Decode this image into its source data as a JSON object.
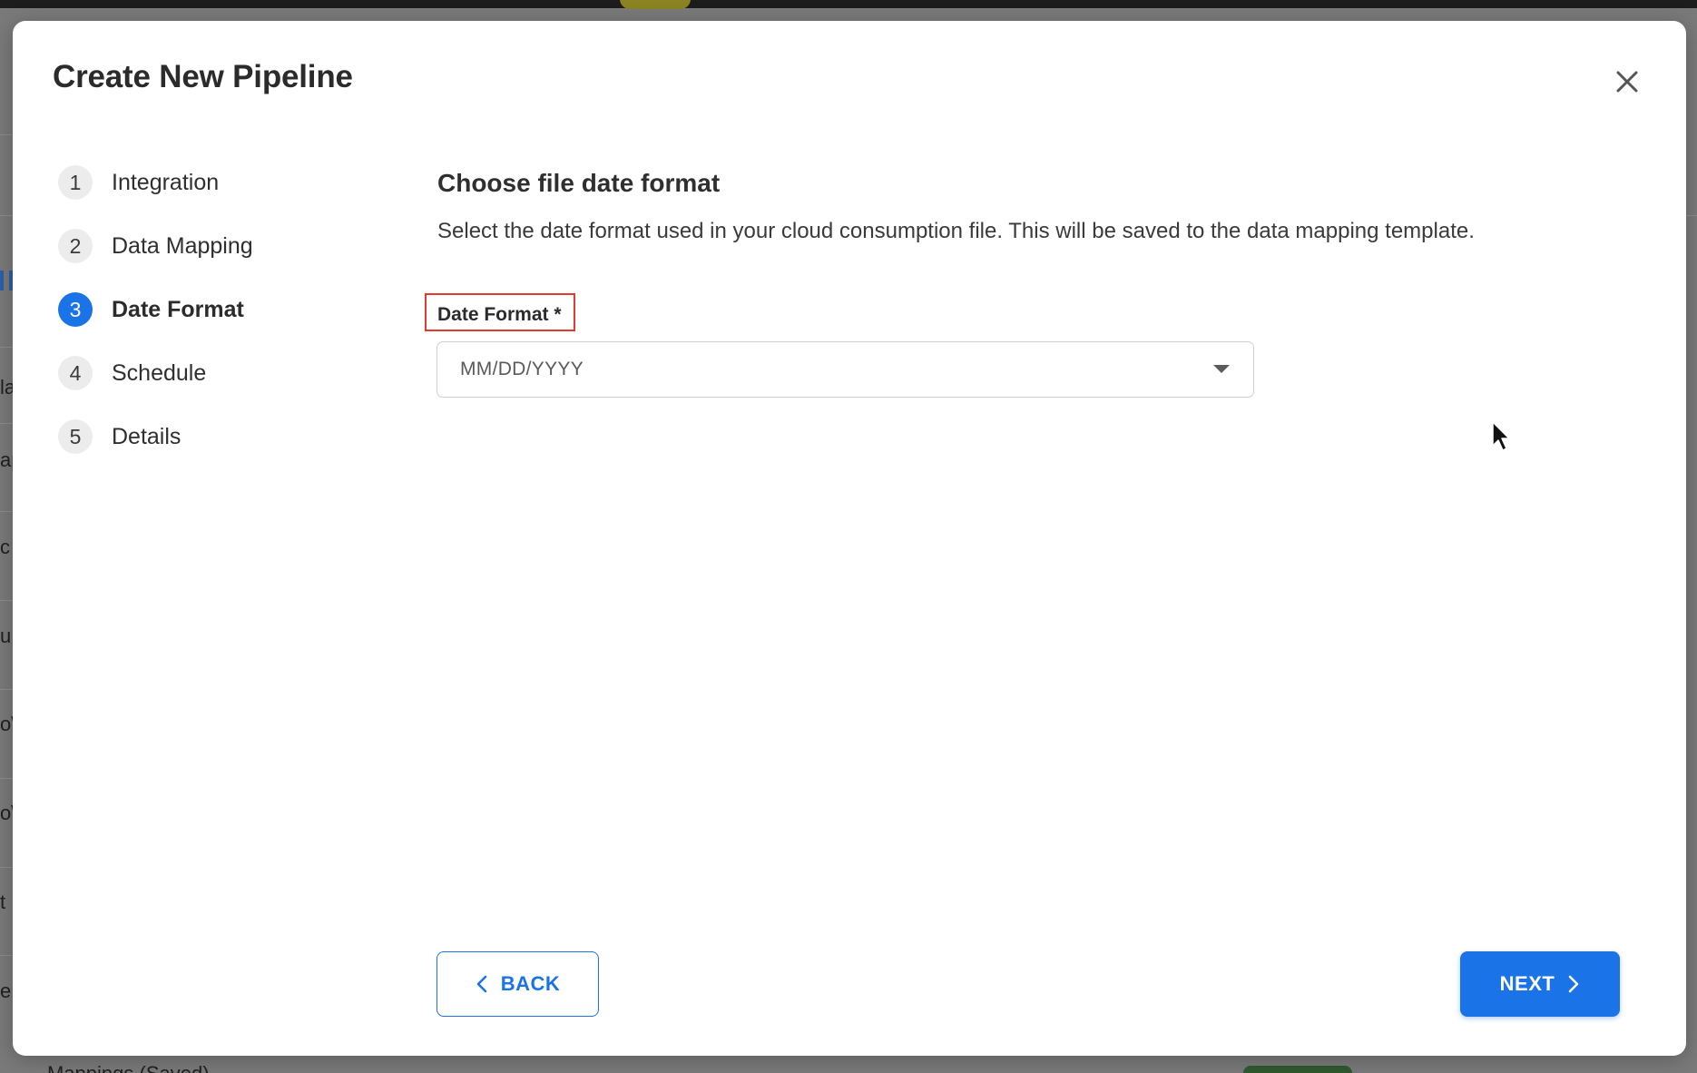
{
  "backdrop": {
    "fragments": [
      "la",
      "ap",
      "c",
      "u",
      "o\\",
      "o\\",
      "t",
      "e"
    ],
    "bottom_text": "Mappings (Saved)"
  },
  "modal": {
    "title": "Create New Pipeline",
    "close_icon": "close-icon"
  },
  "stepper": {
    "steps": [
      {
        "number": "1",
        "label": "Integration",
        "active": false
      },
      {
        "number": "2",
        "label": "Data Mapping",
        "active": false
      },
      {
        "number": "3",
        "label": "Date Format",
        "active": true
      },
      {
        "number": "4",
        "label": "Schedule",
        "active": false
      },
      {
        "number": "5",
        "label": "Details",
        "active": false
      }
    ]
  },
  "content": {
    "title": "Choose file date format",
    "description": "Select the date format used in your cloud consumption file. This will be saved to the data mapping template.",
    "date_format_field": {
      "label": "Date Format *",
      "value": "MM/DD/YYYY",
      "caret_icon": "caret-down-icon"
    }
  },
  "footer": {
    "back_label": "BACK",
    "back_icon": "chevron-left-icon",
    "next_label": "NEXT",
    "next_icon": "chevron-right-icon"
  },
  "colors": {
    "accent": "#1b73e8",
    "highlight_box": "#e23b2e"
  }
}
